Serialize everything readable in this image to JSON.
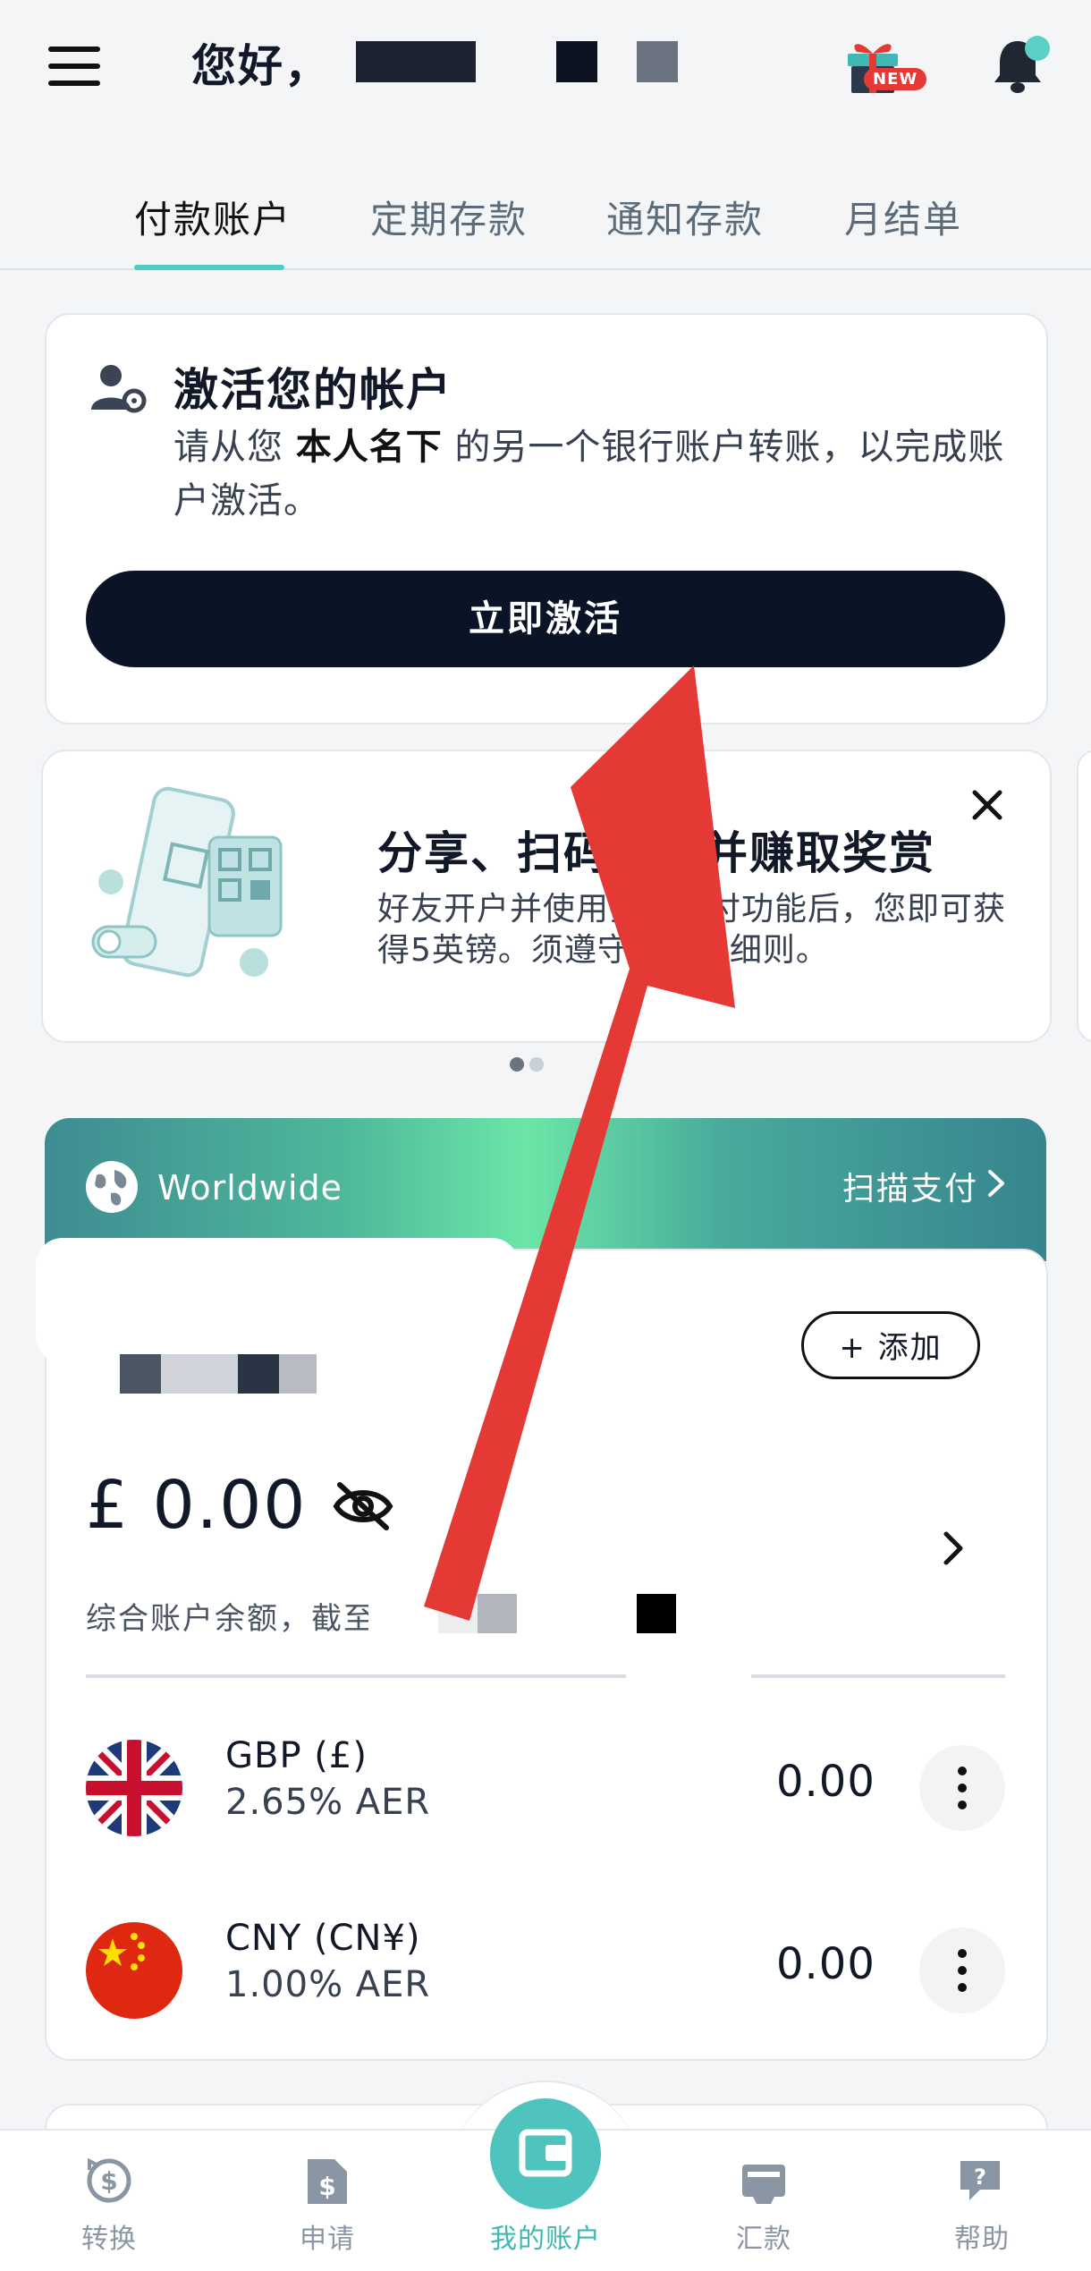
{
  "header": {
    "greeting": "您好，",
    "new_badge": "NEW"
  },
  "tabs": [
    {
      "label": "付款账户",
      "active": true
    },
    {
      "label": "定期存款",
      "active": false
    },
    {
      "label": "通知存款",
      "active": false
    },
    {
      "label": "月结单",
      "active": false
    }
  ],
  "activate_card": {
    "title": "激活您的帐户",
    "desc_prefix": "请从您 ",
    "desc_bold": "本人名下",
    "desc_suffix": " 的另一个银行账户转账，以完成账户激活。",
    "button_label": "立即激活"
  },
  "promo_card": {
    "title": "分享、扫码支付并赚取奖赏",
    "desc": "好友开户并使用扫码支付功能后，您即可获得5英镑。须遵守条款及细则。",
    "pages": 2,
    "active_page": 0
  },
  "worldwide_card": {
    "label": "Worldwide",
    "scan_label": "扫描支付",
    "add_label": "+ 添加",
    "balance": "£ 0.00",
    "balance_caption": "综合账户余额，截至"
  },
  "currencies": [
    {
      "name": "GBP (£)",
      "rate": "2.65% AER",
      "amount": "0.00",
      "flag": "uk-flag-icon"
    },
    {
      "name": "CNY (CN¥)",
      "rate": "1.00% AER",
      "amount": "0.00",
      "flag": "china-flag-icon"
    }
  ],
  "bottom_nav": [
    {
      "label": "转换",
      "icon": "exchange-icon"
    },
    {
      "label": "申请",
      "icon": "apply-icon"
    },
    {
      "label": "我的账户",
      "icon": "wallet-icon",
      "active": true
    },
    {
      "label": "汇款",
      "icon": "remit-icon"
    },
    {
      "label": "帮助",
      "icon": "help-icon"
    }
  ],
  "colors": {
    "accent": "#4ECDC4",
    "primary_button": "#0B1426",
    "annotation_arrow": "#E53935"
  }
}
